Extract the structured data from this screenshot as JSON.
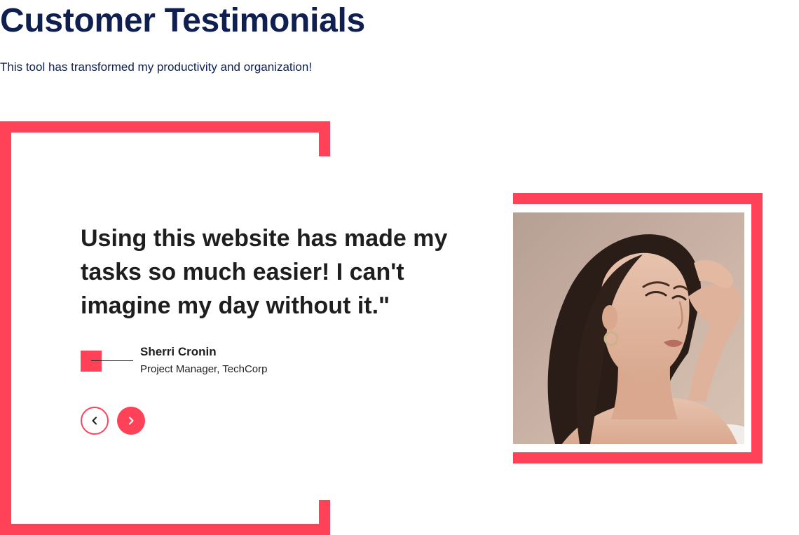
{
  "header": {
    "title": "Customer Testimonials",
    "subtitle": "This tool has transformed my productivity and organization!"
  },
  "testimonial": {
    "quote": "Using this website has made my tasks so much easier! I can't imagine my day without it.\"",
    "author_name": "Sherri Cronin",
    "author_role": "Project Manager, TechCorp",
    "photo_alt": "Photo of Sherri Cronin"
  },
  "navigation": {
    "prev_icon": "chevron-left-icon",
    "next_icon": "chevron-right-icon"
  },
  "colors": {
    "accent": "#ff4258",
    "title": "#0f1f4f",
    "text": "#1e1e1e"
  }
}
